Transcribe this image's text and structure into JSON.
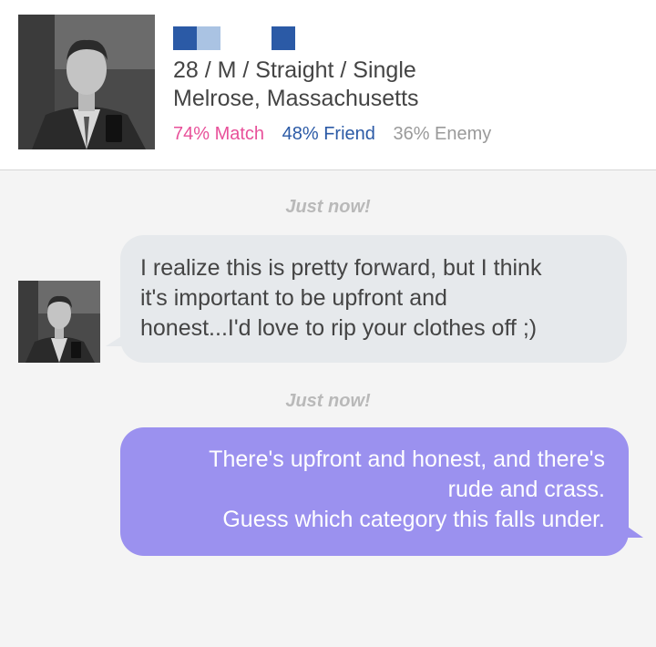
{
  "profile": {
    "details_line1": "28 / M / Straight / Single",
    "details_line2": "Melrose, Massachusetts",
    "match": "74% Match",
    "friend": "48% Friend",
    "enemy": "36% Enemy"
  },
  "conversation": {
    "messages": [
      {
        "timestamp": "Just now!",
        "direction": "incoming",
        "lines": [
          "I realize this is pretty forward, but I think",
          "it's important to be upfront and",
          "honest...I'd love to rip your clothes off ;)"
        ]
      },
      {
        "timestamp": "Just now!",
        "direction": "outgoing",
        "lines": [
          "There's upfront and honest, and there's",
          "rude and crass.",
          "Guess which category this falls under."
        ]
      }
    ]
  },
  "colors": {
    "match": "#e8519a",
    "friend": "#2b5aa6",
    "enemy": "#9a9a9a",
    "outgoing_bubble": "#9b91ef",
    "incoming_bubble": "#e6e9ec"
  }
}
